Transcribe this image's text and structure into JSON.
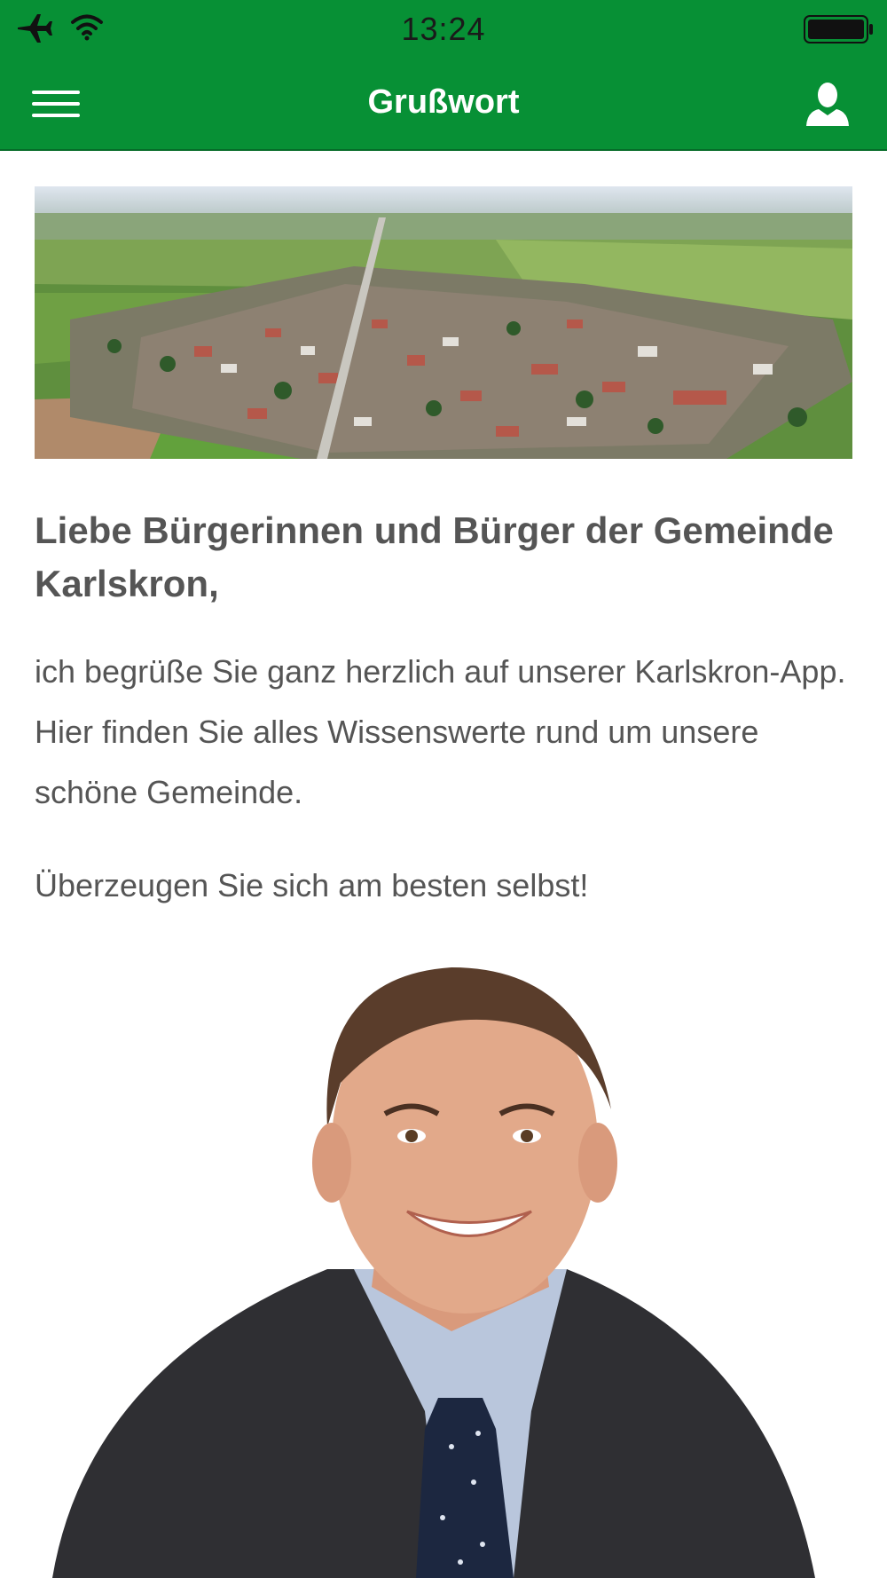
{
  "status_bar": {
    "time": "13:24",
    "icons": [
      "airplane-icon",
      "wifi-icon",
      "battery-icon"
    ]
  },
  "navbar": {
    "title": "Grußwort",
    "menu_icon": "hamburger-menu-icon",
    "user_icon": "user-icon"
  },
  "content": {
    "headline": "Liebe Bürgerinnen und Bürger der Gemeinde Karlskron,",
    "paragraph_1": "ich begrüße Sie ganz herzlich auf unserer Karlskron-App. Hier finden Sie alles Wissenswerte rund um unsere schöne Gemeinde.",
    "paragraph_2": "Überzeugen Sie sich am besten selbst!"
  },
  "colors": {
    "brand_green": "#079035",
    "text_gray": "#555555"
  }
}
